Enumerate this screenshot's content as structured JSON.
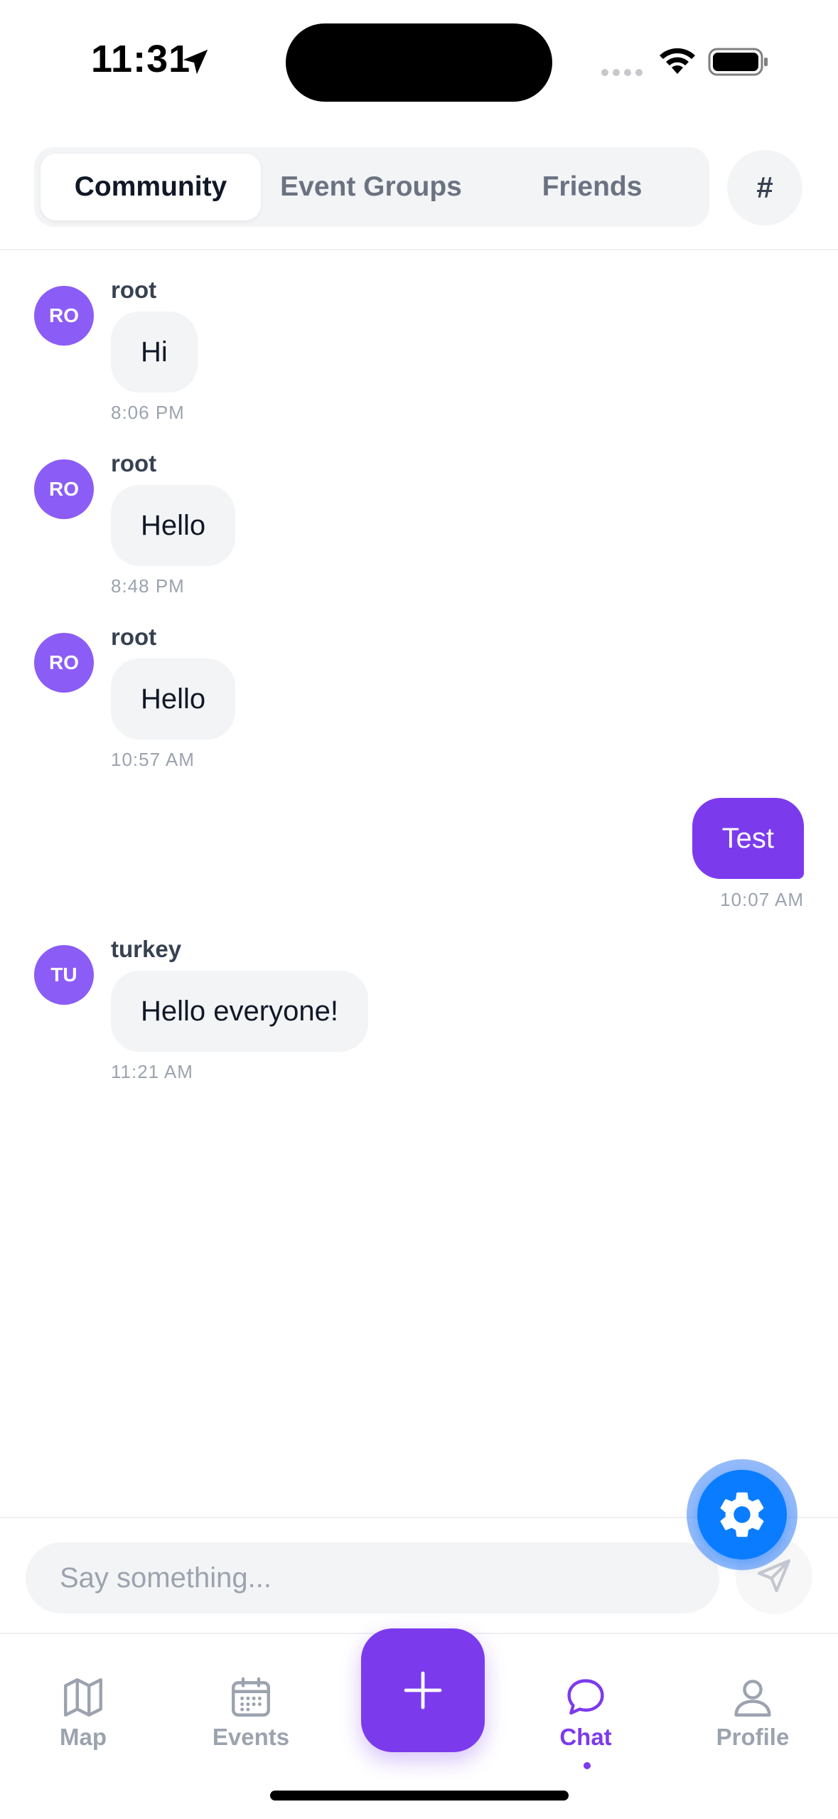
{
  "status_bar": {
    "time": "11:31"
  },
  "tabs": [
    {
      "label": "Community",
      "active": true
    },
    {
      "label": "Event Groups",
      "active": false
    },
    {
      "label": "Friends",
      "active": false
    }
  ],
  "channel_button": {
    "label": "#"
  },
  "messages": [
    {
      "avatar": "RO",
      "sender": "root",
      "text": "Hi",
      "time": "8:06 PM",
      "own": false
    },
    {
      "avatar": "RO",
      "sender": "root",
      "text": "Hello",
      "time": "8:48 PM",
      "own": false
    },
    {
      "avatar": "RO",
      "sender": "root",
      "text": "Hello",
      "time": "10:57 AM",
      "own": false
    },
    {
      "text": "Test",
      "time": "10:07 AM",
      "own": true
    },
    {
      "avatar": "TU",
      "sender": "turkey",
      "text": "Hello everyone!",
      "time": "11:21 AM",
      "own": false
    }
  ],
  "composer": {
    "placeholder": "Say something..."
  },
  "nav": {
    "map": "Map",
    "events": "Events",
    "chat": "Chat",
    "profile": "Profile",
    "active": "chat"
  },
  "colors": {
    "accent": "#7c3aed",
    "avatar": "#8b5cf6",
    "settings_fab": "#0a7cff"
  },
  "icons": {
    "settings": "gear-icon",
    "send": "send-icon",
    "add": "plus-icon"
  }
}
